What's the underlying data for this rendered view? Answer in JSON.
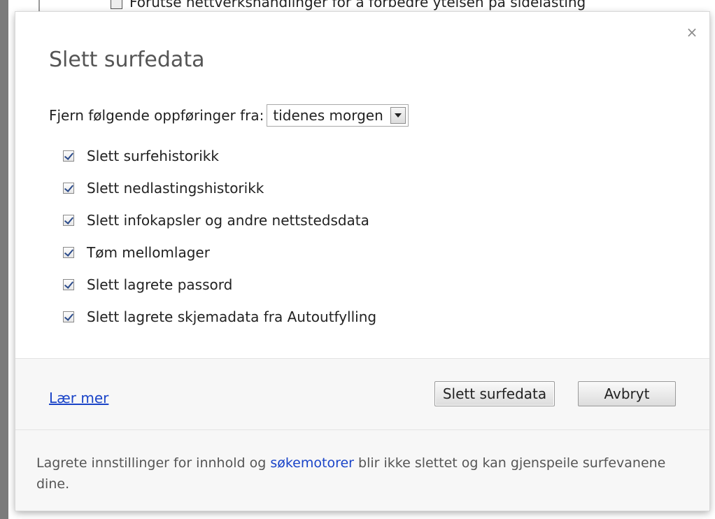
{
  "background": {
    "partial_text": "Forutse nettverkshandlinger for å forbedre ytelsen på sidelasting"
  },
  "dialog": {
    "title": "Slett surfedata",
    "close_glyph": "×",
    "time_range": {
      "label": "Fjern følgende oppføringer fra:",
      "selected": "tidenes morgen"
    },
    "options": [
      {
        "label": "Slett surfehistorikk",
        "checked": true
      },
      {
        "label": "Slett nedlastingshistorikk",
        "checked": true
      },
      {
        "label": "Slett infokapsler og andre nettstedsdata",
        "checked": true
      },
      {
        "label": "Tøm mellomlager",
        "checked": true
      },
      {
        "label": "Slett lagrete passord",
        "checked": true
      },
      {
        "label": "Slett lagrete skjemadata fra Autoutfylling",
        "checked": true
      }
    ],
    "learn_more": "Lær mer",
    "clear_button": "Slett surfedata",
    "cancel_button": "Avbryt",
    "note": {
      "before": "Lagrete innstillinger for innhold og ",
      "link": "søkemotorer",
      "after": " blir ikke slettet og kan gjenspeile surfevanene dine."
    }
  },
  "colors": {
    "link": "#1a44c8",
    "title": "#555555",
    "footer_bg": "#f7f7f7"
  },
  "icons": {
    "close": "close-icon",
    "dropdown": "chevron-down-icon",
    "checkbox": "checkmark-icon"
  }
}
